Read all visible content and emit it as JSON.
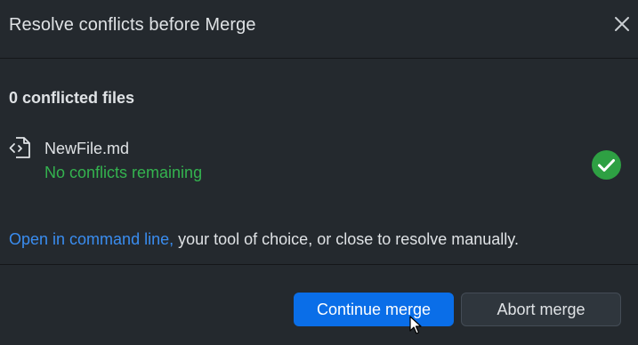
{
  "dialog": {
    "title": "Resolve conflicts before Merge",
    "close_icon": "close-icon"
  },
  "summary": {
    "conflict_count_text": "0 conflicted files"
  },
  "files": [
    {
      "icon": "file-diff-icon",
      "name": "NewFile.md",
      "status": "No conflicts remaining",
      "status_icon": "check-circle-icon"
    }
  ],
  "hint": {
    "link_text": "Open in command line,",
    "rest_text": " your tool of choice, or close to resolve manually."
  },
  "actions": {
    "continue_label": "Continue merge",
    "abort_label": "Abort merge"
  },
  "colors": {
    "background": "#24292e",
    "primary_button": "#0a6ee8",
    "success": "#34b34f",
    "link": "#3a8df0"
  }
}
